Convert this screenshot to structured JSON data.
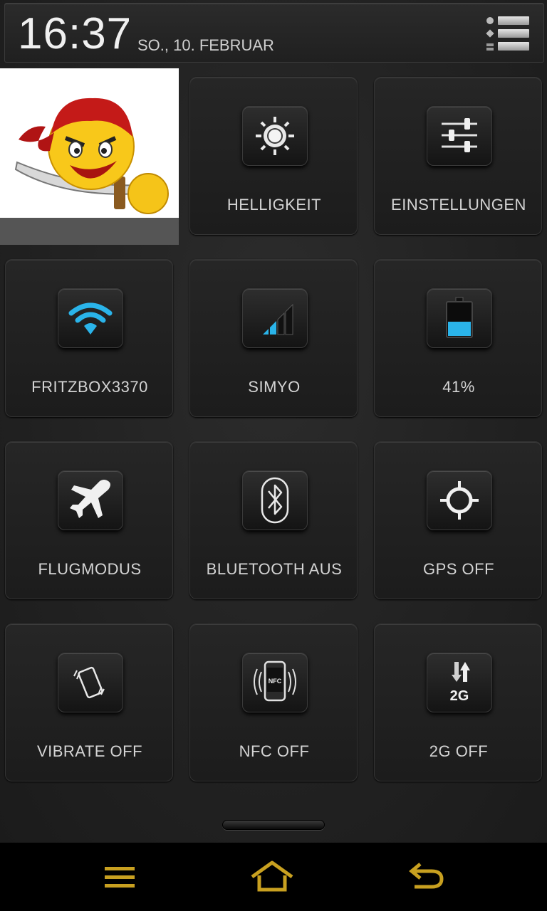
{
  "header": {
    "time": "16:37",
    "date": "SO., 10. FEBRUAR"
  },
  "tiles": [
    {
      "label": "HELLIGKEIT",
      "icon": "brightness-icon"
    },
    {
      "label": "EINSTELLUNGEN",
      "icon": "settings-sliders-icon"
    },
    {
      "label": "FRITZBOX3370",
      "icon": "wifi-icon"
    },
    {
      "label": "SIMYO",
      "icon": "signal-icon"
    },
    {
      "label": "41%",
      "icon": "battery-icon"
    },
    {
      "label": "FLUGMODUS",
      "icon": "airplane-icon"
    },
    {
      "label": "BLUETOOTH AUS",
      "icon": "bluetooth-icon"
    },
    {
      "label": "GPS OFF",
      "icon": "gps-icon"
    },
    {
      "label": "VIBRATE OFF",
      "icon": "vibrate-icon"
    },
    {
      "label": "NFC OFF",
      "icon": "nfc-icon"
    },
    {
      "label": "2G OFF",
      "icon": "2g-icon"
    }
  ],
  "nfc_icon_text": "NFC",
  "twog_icon_text": "2G",
  "battery_level": 0.41,
  "colors": {
    "accent_blue": "#2ab4ea",
    "nav_gold": "#c8a020"
  }
}
